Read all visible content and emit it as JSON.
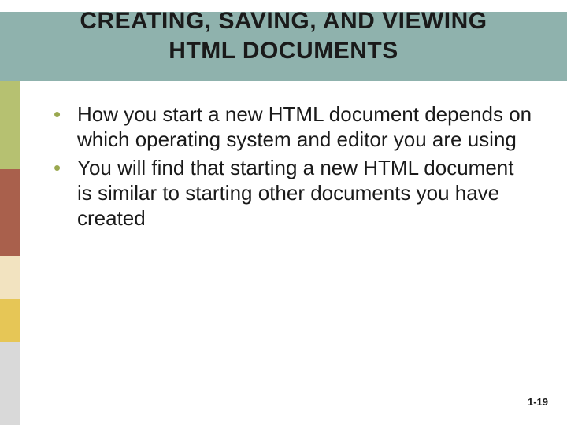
{
  "title": {
    "line1": "CREATING, SAVING, AND VIEWING",
    "line2": "HTML DOCUMENTS"
  },
  "bullets": [
    "How you start a new HTML document depends on which operating system and editor you are using",
    "You will find that starting a new HTML document is similar to starting other documents you have created"
  ],
  "page_number": "1-19",
  "colors": {
    "header_band": "#8fb2ad",
    "bullet_marker": "#9aa84f",
    "stripes": [
      "#b6c171",
      "#a9604c",
      "#f2e3c0",
      "#e6c656",
      "#d9d9d9"
    ]
  }
}
